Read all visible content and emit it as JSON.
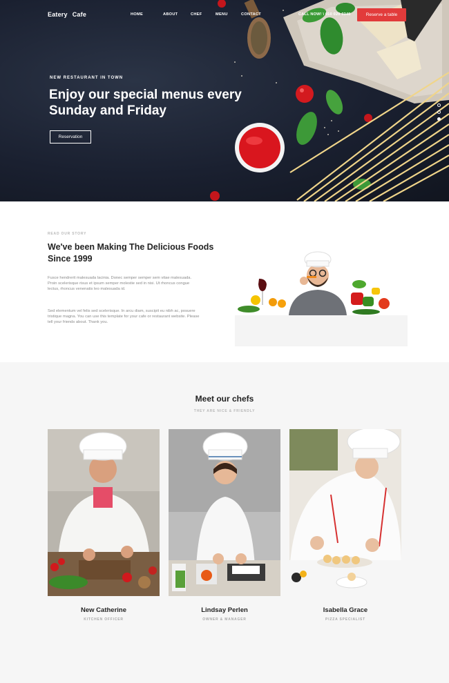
{
  "brand": {
    "word1": "Eatery",
    "word2": "Cafe"
  },
  "nav": {
    "items": [
      {
        "label": "HOME"
      },
      {
        "label": "ABOUT"
      },
      {
        "label": "CHEF"
      },
      {
        "label": "MENU"
      },
      {
        "label": "CONTACT"
      }
    ],
    "call": "CALL NOW! \\ 010 020 0340",
    "reserve_button": "Reserve a table"
  },
  "hero": {
    "kicker": "NEW RESTAURANT IN TOWN",
    "title": "Enjoy our special menus every Sunday and Friday",
    "button": "Reservation",
    "slides": 3,
    "active_slide": 3
  },
  "story": {
    "kicker": "READ OUR STORY",
    "title": "We've been Making The Delicious Foods Since 1999",
    "para1": "Fusce hendrerit malesuada lacinia. Donec semper semper sem vitae malesuada. Proin scelerisque risus et ipsum semper molestie sed in nisi. Ut rhoncus congue lectus, rhoncus venenatis leo malesuada id.",
    "para2": "Sed elementum vel felis sed scelerisque. In arcu diam, suscipit eu nibh ac, posuere tristique magna. You can use this template for your cafe or restaurant website. Please tell your friends about. Thank you."
  },
  "chefs": {
    "title": "Meet our chefs",
    "subtitle": "THEY ARE NICE & FRIENDLY",
    "members": [
      {
        "name": "New Catherine",
        "role": "KITCHEN OFFICER"
      },
      {
        "name": "Lindsay Perlen",
        "role": "OWNER & MANAGER"
      },
      {
        "name": "Isabella Grace",
        "role": "PIZZA SPECIALIST"
      }
    ]
  },
  "colors": {
    "accent": "#e23b3b",
    "hero_bg": "#1a2030"
  }
}
